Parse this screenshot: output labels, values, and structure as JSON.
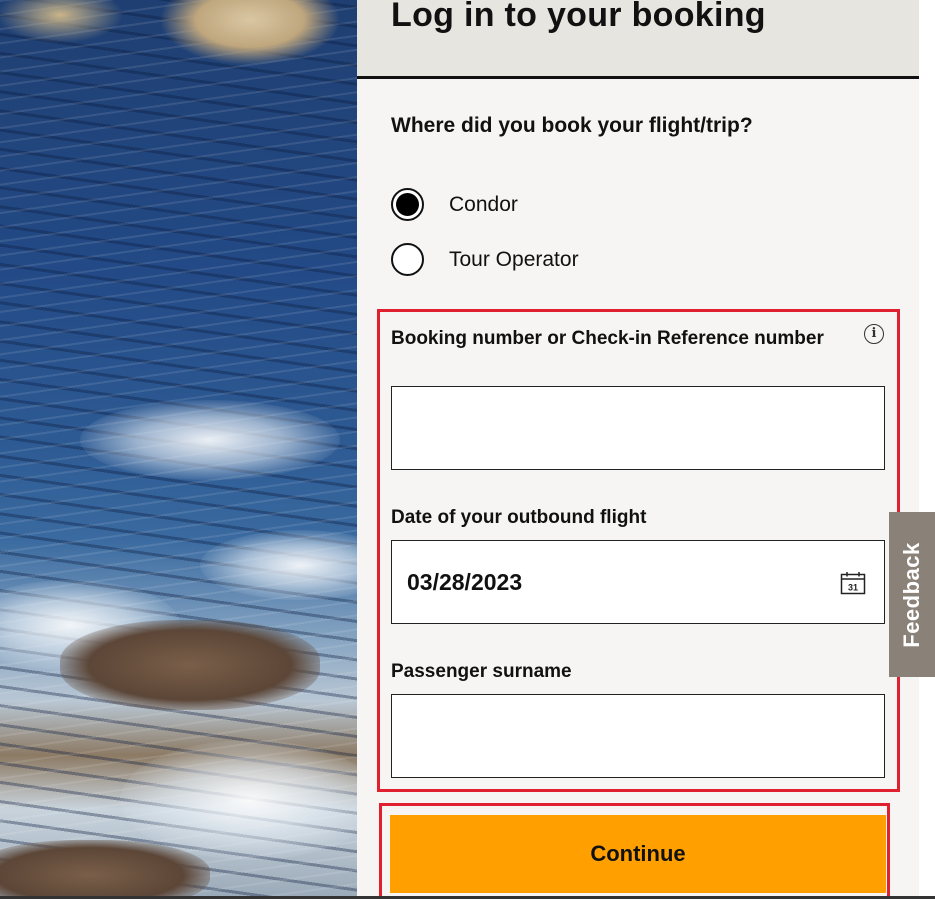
{
  "header": {
    "title": "Log in to your booking"
  },
  "booking_source": {
    "question": "Where did you book your flight/trip?",
    "options": [
      {
        "label": "Condor",
        "selected": true
      },
      {
        "label": "Tour Operator",
        "selected": false
      }
    ]
  },
  "form": {
    "booking_number": {
      "label": "Booking number or Check-in Reference number",
      "value": ""
    },
    "outbound_date": {
      "label": "Date of your outbound flight",
      "value": "03/28/2023",
      "icon": "calendar-icon",
      "icon_day": "31"
    },
    "surname": {
      "label": "Passenger surname",
      "value": ""
    }
  },
  "continue_label": "Continue",
  "feedback_label": "Feedback",
  "colors": {
    "accent_button": "#ffa000",
    "highlight_border": "#e0202e",
    "panel_background": "#f6f5f3",
    "header_background": "#e7e5e0",
    "feedback_tab": "#8a8178"
  }
}
